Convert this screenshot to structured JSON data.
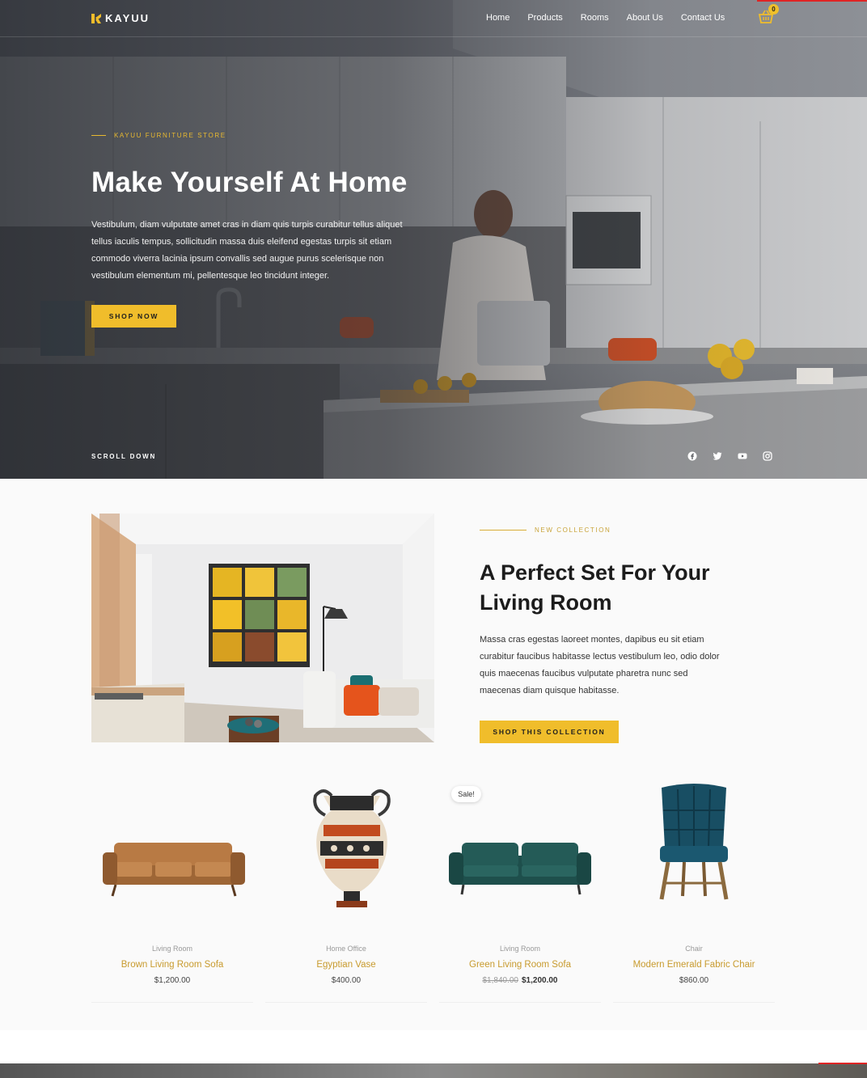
{
  "brand": {
    "name": "KAYUU",
    "accent": "#f0bd2b"
  },
  "nav": {
    "items": [
      {
        "label": "Home"
      },
      {
        "label": "Products"
      },
      {
        "label": "Rooms"
      },
      {
        "label": "About Us"
      },
      {
        "label": "Contact Us"
      }
    ],
    "cart_count": "0",
    "cart_icon": "basket-icon"
  },
  "hero": {
    "eyebrow": "KAYUU FURNITURE STORE",
    "title": "Make Yourself At Home",
    "text": "Vestibulum, diam vulputate amet cras in diam quis turpis curabitur tellus aliquet tellus iaculis tempus, sollicitudin massa duis eleifend egestas turpis sit etiam commodo viverra lacinia ipsum convallis sed augue purus scelerisque non vestibulum elementum mi, pellentesque leo tincidunt integer.",
    "button": "SHOP NOW",
    "scroll": "SCROLL DOWN",
    "socials": [
      "facebook-icon",
      "twitter-icon",
      "youtube-icon",
      "instagram-icon"
    ]
  },
  "collection": {
    "eyebrow": "NEW COLLECTION",
    "title": "A Perfect Set For Your Living Room",
    "text": "Massa cras egestas laoreet montes, dapibus eu sit etiam curabitur faucibus habitasse lectus vestibulum leo, odio dolor quis maecenas faucibus vulputate pharetra nunc sed maecenas diam quisque habitasse.",
    "button": "SHOP THIS COLLECTION"
  },
  "products": [
    {
      "category": "Living Room",
      "name": "Brown Living Room Sofa",
      "price": "$1,200.00"
    },
    {
      "category": "Home Office",
      "name": "Egyptian Vase",
      "price": "$400.00"
    },
    {
      "category": "Living Room",
      "name": "Green Living Room Sofa",
      "old_price": "$1,840.00",
      "price": "$1,200.00",
      "badge": "Sale!"
    },
    {
      "category": "Chair",
      "name": "Modern Emerald Fabric Chair",
      "price": "$860.00"
    }
  ]
}
